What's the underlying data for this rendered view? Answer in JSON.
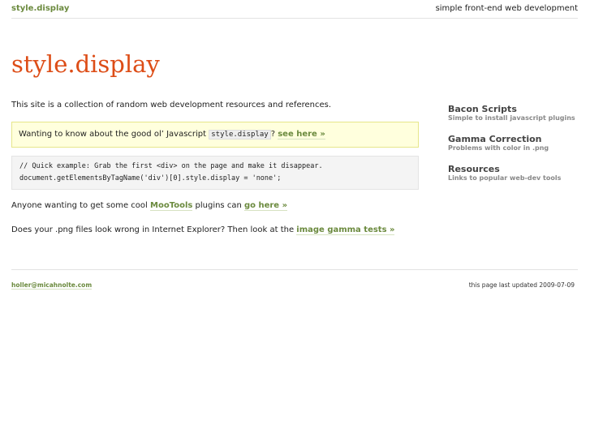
{
  "header": {
    "brand": "style.display",
    "tagline": "simple front-end web development"
  },
  "title": "style.display",
  "main": {
    "intro": "This site is a collection of random web development resources and references.",
    "note": {
      "text": "Wanting to know about the good ol’ Javascript ",
      "code": "style.display",
      "after": "?",
      "link": "see here »"
    },
    "code": [
      "// Quick example: Grab the first <div> on the page and make it disappear.",
      "document.getElementsByTagName('div')[0].style.display = 'none';"
    ],
    "mootools": {
      "before": "Anyone wanting to get some cool ",
      "link1": "MooTools",
      "middle": " plugins can ",
      "link2": "go here »"
    },
    "png": {
      "before": "Does your .png files look wrong in Internet Explorer? Then look at the ",
      "link": "image gamma tests »"
    }
  },
  "sidebar": [
    {
      "title": "Bacon Scripts",
      "desc": "Simple to install javascript plugins"
    },
    {
      "title": "Gamma Correction",
      "desc": "Problems with color in .png"
    },
    {
      "title": "Resources",
      "desc": "Links to popular web-dev tools"
    }
  ],
  "footer": {
    "email": "holler@micahnolte.com",
    "updated": "this page last updated 2009-07-09"
  }
}
